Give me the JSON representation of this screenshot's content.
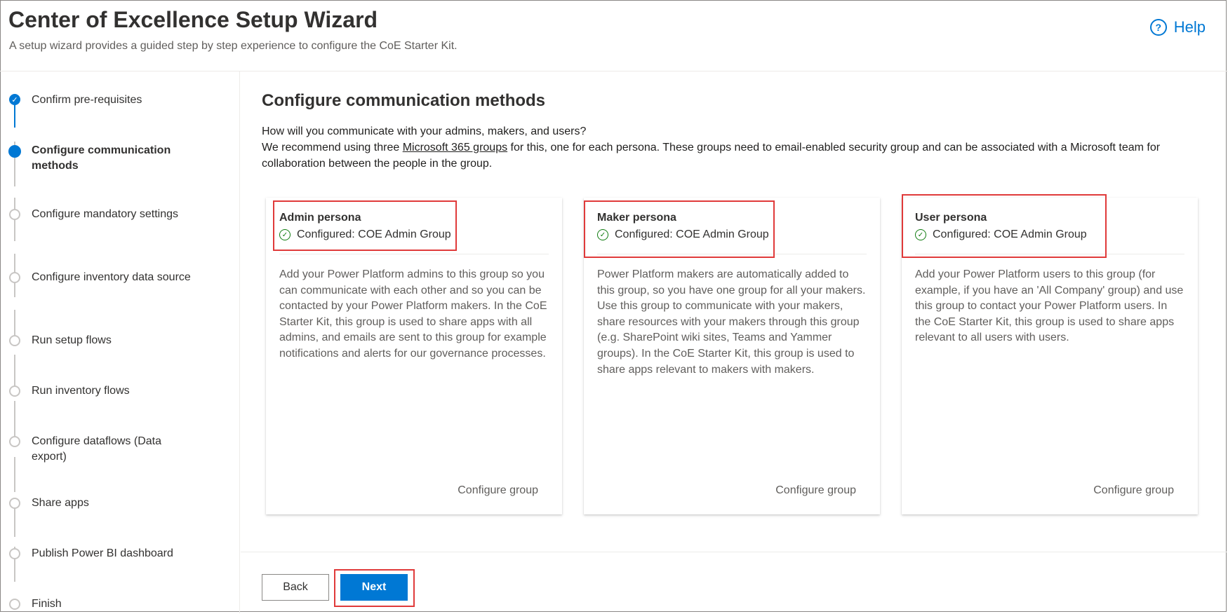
{
  "header": {
    "title": "Center of Excellence Setup Wizard",
    "subtitle": "A setup wizard provides a guided step by step experience to configure the CoE Starter Kit.",
    "help_label": "Help"
  },
  "steps": [
    {
      "label": "Confirm pre-requisites",
      "state": "done"
    },
    {
      "label": "Configure communication methods",
      "state": "current"
    },
    {
      "label": "Configure mandatory settings",
      "state": "todo"
    },
    {
      "label": "Configure inventory data source",
      "state": "todo"
    },
    {
      "label": "Run setup flows",
      "state": "todo"
    },
    {
      "label": "Run inventory flows",
      "state": "todo"
    },
    {
      "label": "Configure dataflows (Data export)",
      "state": "todo"
    },
    {
      "label": "Share apps",
      "state": "todo"
    },
    {
      "label": "Publish Power BI dashboard",
      "state": "todo"
    },
    {
      "label": "Finish",
      "state": "todo"
    }
  ],
  "main": {
    "heading": "Configure communication methods",
    "question": "How will you communicate with your admins, makers, and users?",
    "recommend_prefix": "We recommend using three ",
    "recommend_link": "Microsoft 365 groups",
    "recommend_suffix": " for this, one for each persona. These groups need to email-enabled security group and can be associated with a Microsoft team for collaboration between the people in the group."
  },
  "cards": [
    {
      "name": "Admin persona",
      "status": "Configured: COE Admin Group",
      "description": "Add your Power Platform admins to this group so you can communicate with each other and so you can be contacted by your Power Platform makers. In the CoE Starter Kit, this group is used to share apps with all admins, and emails are sent to this group for example notifications and alerts for our governance processes.",
      "action": "Configure group"
    },
    {
      "name": "Maker persona",
      "status": "Configured: COE Admin Group",
      "description": "Power Platform makers are automatically added to this group, so you have one group for all your makers. Use this group to communicate with your makers, share resources with your makers through this group (e.g. SharePoint wiki sites, Teams and Yammer groups). In the CoE Starter Kit, this group is used to share apps relevant to makers with makers.",
      "action": "Configure group"
    },
    {
      "name": "User persona",
      "status": "Configured: COE Admin Group",
      "description": "Add your Power Platform users to this group (for example, if you have an 'All Company' group) and use this group to contact your Power Platform users. In the CoE Starter Kit, this group is used to share apps relevant to all users with users.",
      "action": "Configure group"
    }
  ],
  "footer": {
    "back_label": "Back",
    "next_label": "Next"
  },
  "colors": {
    "accent": "#0078d4",
    "success": "#107c10",
    "highlight": "#e03a3a"
  }
}
